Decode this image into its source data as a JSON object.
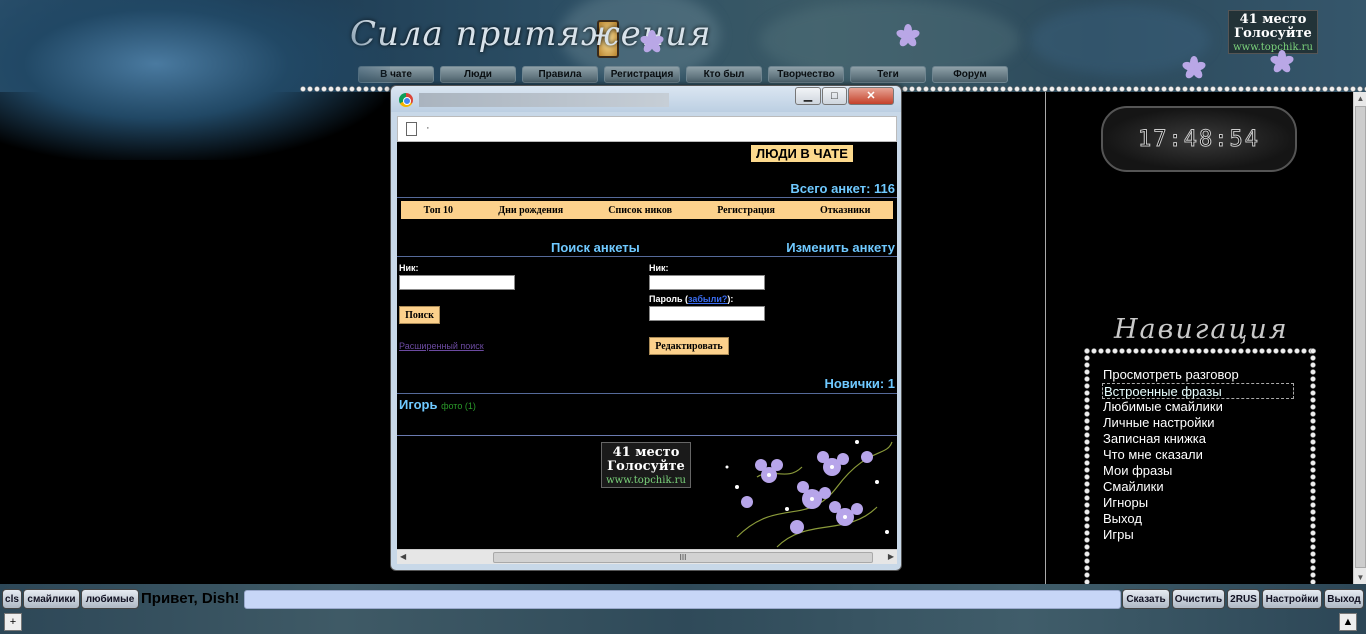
{
  "header": {
    "site_title": "Сила притяжения",
    "nav": [
      "В чате",
      "Люди",
      "Правила",
      "Регистрация",
      "Кто был",
      "Творчество",
      "Теги",
      "Форум"
    ],
    "vote": {
      "line1": "41 место",
      "line2": "Голосуйте",
      "url": "www.topchik.ru"
    }
  },
  "sidebar": {
    "clock": "17:48:54",
    "nav_heading": "Навигация",
    "nav_items": [
      "Просмотреть разговор",
      "Встроенные фразы",
      "Любимые смайлики",
      "Личные настройки",
      "Записная книжка",
      "Что мне сказали",
      "Мои фразы",
      "Смайлики",
      "Игноры",
      "Выход",
      "Игры"
    ],
    "selected_index": 1
  },
  "popup": {
    "address_text": "·",
    "win_buttons": {
      "minimize": "▁",
      "maximize": "□",
      "close": "✕"
    },
    "people_badge": "ЛЮДИ В ЧАТЕ",
    "total_label": "Всего анкет: 116",
    "tabs": [
      "Топ 10",
      "Дни рождения",
      "Список ников",
      "Регистрация",
      "Отказники"
    ],
    "search": {
      "heading": "Поиск анкеты",
      "nick_label": "Ник:",
      "button": "Поиск",
      "advanced_link": "Расширенный поиск"
    },
    "edit": {
      "heading": "Изменить анкету",
      "nick_label": "Ник:",
      "password_label_prefix": "Пароль (",
      "forgot_link": "забыли?",
      "password_label_suffix": "):",
      "button": "Редактировать"
    },
    "newbies_label": "Новички: 1",
    "newbie": {
      "name": "Игорь",
      "photo": "фото (1)"
    },
    "vote": {
      "line1": "41 место",
      "line2": "Голосуйте",
      "url": "www.topchik.ru"
    },
    "hscroll_grip": "III"
  },
  "bottombar": {
    "left_buttons": [
      "cls",
      "смайлики",
      "любимые"
    ],
    "greeting": "Привет, Dish!",
    "right_buttons": [
      "Сказать",
      "Очистить",
      "2RUS",
      "Настройки",
      "Выход"
    ],
    "plus": "+",
    "up": "▲"
  },
  "colors": {
    "accent_cyan": "#6fc9ff",
    "tab_bg": "#fcd18c",
    "chat_input": "#c7d6f7"
  }
}
